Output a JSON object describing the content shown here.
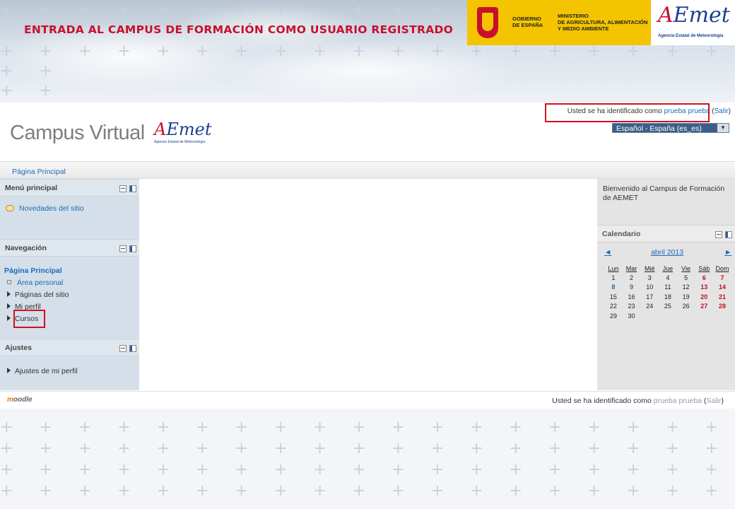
{
  "banner": {
    "title": "ENTRADA AL CAMPUS DE FORMACIÓN COMO USUARIO REGISTRADO",
    "gov_line1": "GOBIERNO",
    "gov_line2": "DE ESPAÑA",
    "ministry_line1": "MINISTERIO",
    "ministry_line2": "DE AGRICULTURA, ALIMENTACIÓN",
    "ministry_line3": "Y MEDIO AMBIENTE",
    "aemet_logo_a": "A",
    "aemet_logo_rest": "Emet",
    "aemet_sub": "Agencia Estatal de Meteorología",
    "accent": "#c8102e"
  },
  "header": {
    "login_prefix": "Usted se ha identificado como ",
    "login_user": "prueba prueba",
    "login_open": " (",
    "logout": "Salir",
    "login_close": ")",
    "brand": "Campus Virtual",
    "brand_logo_a": "A",
    "brand_logo_rest": "Emet",
    "brand_sub": "Agencia Estatal de Meteorología",
    "language": "Español - España (es_es)"
  },
  "breadcrumb": {
    "home": "Página Principal"
  },
  "blocks": {
    "main_menu": {
      "title": "Menú principal",
      "items": [
        "Novedades del sitio"
      ]
    },
    "navigation": {
      "title": "Navegación",
      "home": "Página Principal",
      "items": [
        "Área personal",
        "Páginas del sitio",
        "Mi perfil",
        "Cursos"
      ]
    },
    "settings": {
      "title": "Ajustes",
      "items": [
        "Ajustes de mi perfil"
      ]
    }
  },
  "right": {
    "welcome": "Bienvenido al Campus de Formación de AEMET",
    "calendar": {
      "title": "Calendario",
      "month": "abril 2013",
      "prev": "◄",
      "next": "►",
      "days": [
        "Lun",
        "Mar",
        "Mié",
        "Jue",
        "Vie",
        "Sáb",
        "Dom"
      ],
      "weeks": [
        [
          "1",
          "2",
          "3",
          "4",
          "5",
          "6",
          "7"
        ],
        [
          "8",
          "9",
          "10",
          "11",
          "12",
          "13",
          "14"
        ],
        [
          "15",
          "16",
          "17",
          "18",
          "19",
          "20",
          "21"
        ],
        [
          "22",
          "23",
          "24",
          "25",
          "26",
          "27",
          "28"
        ],
        [
          "29",
          "30",
          "",
          "",
          "",
          "",
          ""
        ]
      ]
    }
  },
  "footer": {
    "moodle_m": "m",
    "moodle_rest": "oodle",
    "login_prefix": "Usted se ha identificado como ",
    "login_user": "prueba prueba",
    "login_open": " (",
    "logout": "Salir",
    "login_close": ")"
  }
}
